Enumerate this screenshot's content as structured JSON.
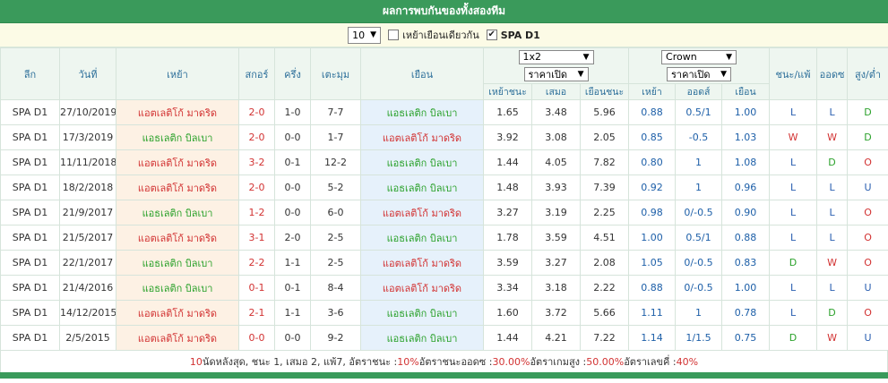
{
  "title": "ผลการพบกันของทั้งสองทีม",
  "filter": {
    "count": "10",
    "same_venue_label": "เหย้าเยือนเดียวกัน",
    "same_venue_checked": false,
    "league_label": "SPA D1",
    "league_checked": true
  },
  "headers": {
    "league": "ลีก",
    "date": "วันที่",
    "home": "เหย้า",
    "score": "สกอร์",
    "half": "ครึ่ง",
    "corner": "เตะมุม",
    "away": "เยือน",
    "odds_type": "1x2",
    "odds_price": "ราคาเปิด",
    "home_win": "เหย้าชนะ",
    "draw": "เสมอ",
    "away_win": "เยือนชนะ",
    "company": "Crown",
    "company_price": "ราคาเปิด",
    "ah_home": "เหย้า",
    "ah_line": "ออดส์",
    "ah_away": "เยือน",
    "result": "ชนะ/แพ้",
    "ah_result": "ออดซ",
    "ou": "สูง/ต่ำ"
  },
  "rows": [
    {
      "league": "SPA D1",
      "date": "27/10/2019",
      "home": "แอตเลติโก้ มาดริด",
      "score": "2-0",
      "half": "1-0",
      "corner": "7-7",
      "away": "แอธเลติก บิลเบา",
      "h": "1.65",
      "d": "3.48",
      "a": "5.96",
      "ah_h": "0.88",
      "ah": "0.5/1",
      "ah_a": "1.00",
      "res": "L",
      "ahres": "L",
      "ou": "D",
      "hl": "home"
    },
    {
      "league": "SPA D1",
      "date": "17/3/2019",
      "home": "แอธเลติก บิลเบา",
      "score": "2-0",
      "half": "0-0",
      "corner": "1-7",
      "away": "แอตเลติโก้ มาดริด",
      "h": "3.92",
      "d": "3.08",
      "a": "2.05",
      "ah_h": "0.85",
      "ah": "-0.5",
      "ah_a": "1.03",
      "res": "W",
      "ahres": "W",
      "ou": "D",
      "hl": "home"
    },
    {
      "league": "SPA D1",
      "date": "11/11/2018",
      "home": "แอตเลติโก้ มาดริด",
      "score": "3-2",
      "half": "0-1",
      "corner": "12-2",
      "away": "แอธเลติก บิลเบา",
      "h": "1.44",
      "d": "4.05",
      "a": "7.82",
      "ah_h": "0.80",
      "ah": "1",
      "ah_a": "1.08",
      "res": "L",
      "ahres": "D",
      "ou": "O",
      "hl": "home"
    },
    {
      "league": "SPA D1",
      "date": "18/2/2018",
      "home": "แอตเลติโก้ มาดริด",
      "score": "2-0",
      "half": "0-0",
      "corner": "5-2",
      "away": "แอธเลติก บิลเบา",
      "h": "1.48",
      "d": "3.93",
      "a": "7.39",
      "ah_h": "0.92",
      "ah": "1",
      "ah_a": "0.96",
      "res": "L",
      "ahres": "L",
      "ou": "U",
      "hl": "home"
    },
    {
      "league": "SPA D1",
      "date": "21/9/2017",
      "home": "แอธเลติก บิลเบา",
      "score": "1-2",
      "half": "0-0",
      "corner": "6-0",
      "away": "แอตเลติโก้ มาดริด",
      "h": "3.27",
      "d": "3.19",
      "a": "2.25",
      "ah_h": "0.98",
      "ah": "0/-0.5",
      "ah_a": "0.90",
      "res": "L",
      "ahres": "L",
      "ou": "O",
      "hl": "home"
    },
    {
      "league": "SPA D1",
      "date": "21/5/2017",
      "home": "แอตเลติโก้ มาดริด",
      "score": "3-1",
      "half": "2-0",
      "corner": "2-5",
      "away": "แอธเลติก บิลเบา",
      "h": "1.78",
      "d": "3.59",
      "a": "4.51",
      "ah_h": "1.00",
      "ah": "0.5/1",
      "ah_a": "0.88",
      "res": "L",
      "ahres": "L",
      "ou": "O",
      "hl": "home"
    },
    {
      "league": "SPA D1",
      "date": "22/1/2017",
      "home": "แอธเลติก บิลเบา",
      "score": "2-2",
      "half": "1-1",
      "corner": "2-5",
      "away": "แอตเลติโก้ มาดริด",
      "h": "3.59",
      "d": "3.27",
      "a": "2.08",
      "ah_h": "1.05",
      "ah": "0/-0.5",
      "ah_a": "0.83",
      "res": "D",
      "ahres": "W",
      "ou": "O",
      "hl": "home"
    },
    {
      "league": "SPA D1",
      "date": "21/4/2016",
      "home": "แอธเลติก บิลเบา",
      "score": "0-1",
      "half": "0-1",
      "corner": "8-4",
      "away": "แอตเลติโก้ มาดริด",
      "h": "3.34",
      "d": "3.18",
      "a": "2.22",
      "ah_h": "0.88",
      "ah": "0/-0.5",
      "ah_a": "1.00",
      "res": "L",
      "ahres": "L",
      "ou": "U",
      "hl": "home"
    },
    {
      "league": "SPA D1",
      "date": "14/12/2015",
      "home": "แอตเลติโก้ มาดริด",
      "score": "2-1",
      "half": "1-1",
      "corner": "3-6",
      "away": "แอธเลติก บิลเบา",
      "h": "1.60",
      "d": "3.72",
      "a": "5.66",
      "ah_h": "1.11",
      "ah": "1",
      "ah_a": "0.78",
      "res": "L",
      "ahres": "D",
      "ou": "O",
      "hl": "home"
    },
    {
      "league": "SPA D1",
      "date": "2/5/2015",
      "home": "แอตเลติโก้ มาดริด",
      "score": "0-0",
      "half": "0-0",
      "corner": "9-2",
      "away": "แอธเลติก บิลเบา",
      "h": "1.44",
      "d": "4.21",
      "a": "7.22",
      "ah_h": "1.14",
      "ah": "1/1.5",
      "ah_a": "0.75",
      "res": "D",
      "ahres": "W",
      "ou": "U",
      "hl": "home"
    }
  ],
  "summary": {
    "count": "10",
    "text1": " นัดหลังสุด, ชนะ 1, เสมอ 2, แพ้7, อัตราชนะ : ",
    "win_rate": "10%",
    "text2": " อัตราชนะออดซ : ",
    "ah_rate": "30.00%",
    "text3": " อัตราเกมสูง : ",
    "over_rate": "50.00%",
    "text4": " อัตราเลขคี่ : ",
    "odd_rate": "40%"
  },
  "colors": {
    "title_bg": "#3a9a5b",
    "filter_bg": "#fcfbe6",
    "header_bg": "#eef6f0",
    "home_highlight": "#fdf1e4",
    "away_highlight": "#e6f1fb",
    "red": "#d23232",
    "blue": "#2a5fb0",
    "green": "#2aa12a"
  }
}
